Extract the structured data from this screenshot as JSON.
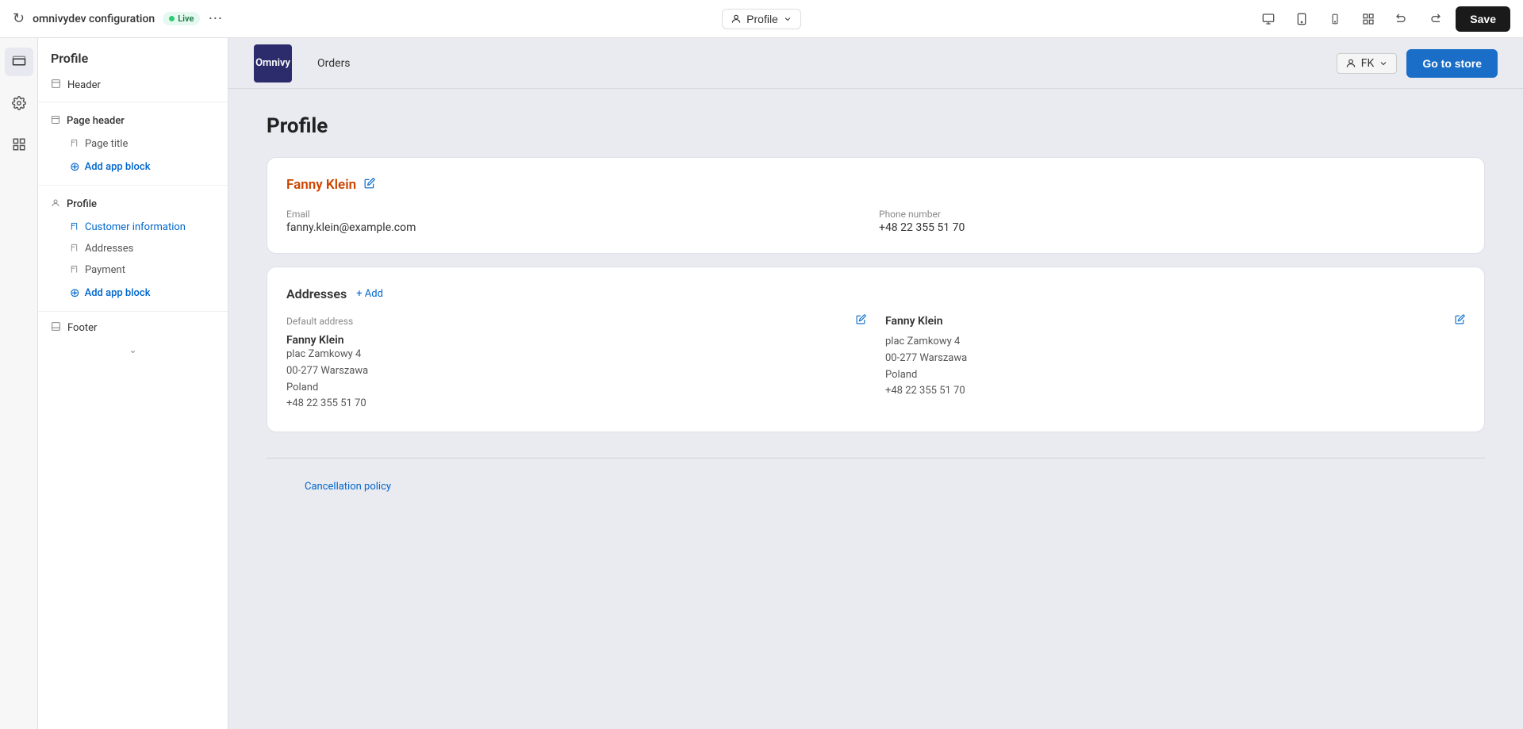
{
  "topbar": {
    "site_name": "omnivydev configuration",
    "live_label": "Live",
    "more_tooltip": "More options",
    "profile_label": "Profile",
    "save_label": "Save"
  },
  "sidebar": {
    "title": "Profile",
    "header_item": "Header",
    "page_header_section": "Page header",
    "page_title_item": "Page title",
    "add_block_label_1": "Add app block",
    "profile_section": "Profile",
    "customer_info_item": "Customer information",
    "addresses_item": "Addresses",
    "payment_item": "Payment",
    "add_block_label_2": "Add app block",
    "footer_item": "Footer"
  },
  "store": {
    "logo_text": "Omnivy",
    "nav_links": [
      "Orders"
    ],
    "user_initials": "FK",
    "go_store_label": "Go to store"
  },
  "profile": {
    "title": "Profile",
    "customer": {
      "name": "Fanny Klein",
      "email_label": "Email",
      "email_value": "fanny.klein@example.com",
      "phone_label": "Phone number",
      "phone_value": "+48 22 355 51 70"
    },
    "addresses": {
      "title": "Addresses",
      "add_label": "+ Add",
      "default": {
        "type": "Default address",
        "name": "Fanny Klein",
        "line1": "plac Zamkowy 4",
        "line2": "00-277 Warszawa",
        "country": "Poland",
        "phone": "+48 22 355 51 70"
      },
      "second": {
        "type": "",
        "name": "Fanny Klein",
        "line1": "plac Zamkowy 4",
        "line2": "00-277 Warszawa",
        "country": "Poland",
        "phone": "+48 22 355 51 70"
      }
    }
  },
  "footer": {
    "cancellation_policy": "Cancellation policy"
  }
}
